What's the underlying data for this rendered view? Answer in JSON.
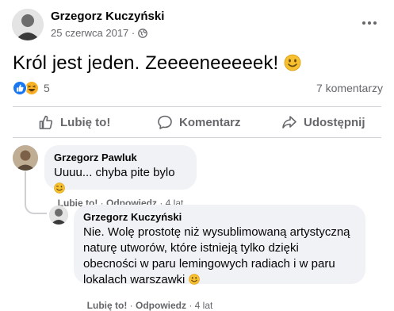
{
  "post": {
    "author": "Grzegorz Kuczyński",
    "date": "25 czerwca 2017",
    "dot": " · ",
    "privacy_icon": "globe-icon",
    "more_icon": "more-options-icon",
    "text": "Król jest jeden. Zeeeeneeeeek!",
    "reaction_count": "5",
    "comments_count": "7 komentarzy"
  },
  "actions": {
    "like": "Lubię to!",
    "comment": "Komentarz",
    "share": "Udostępnij"
  },
  "comments": [
    {
      "author": "Grzegorz Pawluk",
      "text": "Uuuu... chyba pite bylo",
      "like": "Lubię to!",
      "reply": "Odpowiedz",
      "time": "4 lat",
      "sep": " · "
    },
    {
      "author": "Grzegorz Kuczyński",
      "lines": [
        "Nie. Wolę prostotę niż wysublimowaną artystyczną",
        "naturę utworów, które istnieją tylko dzięki",
        "obecności w paru lemingowych radiach i w paru",
        "lokalach warszawki"
      ],
      "like": "Lubię to!",
      "reply": "Odpowiedz",
      "time": "4 lat",
      "sep": " · "
    }
  ],
  "colors": {
    "like_blue": "#1877f2",
    "haha_yellow": "#f7b125",
    "text_secondary": "#65676b",
    "bubble_bg": "#f0f2f5"
  }
}
